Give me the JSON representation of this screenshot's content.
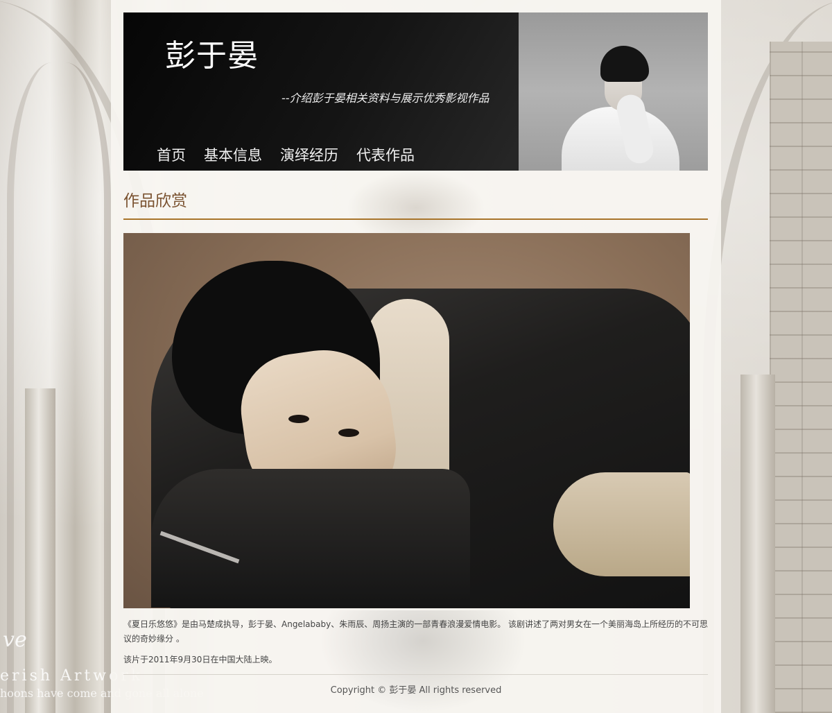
{
  "header": {
    "title": "彭于晏",
    "subtitle": "--介绍彭于晏相关资料与展示优秀影视作品",
    "nav": [
      {
        "label": "首页"
      },
      {
        "label": "基本信息"
      },
      {
        "label": "演绎经历"
      },
      {
        "label": "代表作品"
      }
    ],
    "photo": "portrait-photo"
  },
  "section": {
    "title": "作品欣赏",
    "accent_color": "#a8742a",
    "title_color": "#7a5230"
  },
  "feature": {
    "image": "feature-photo"
  },
  "description": {
    "paragraph_1": "《夏日乐悠悠》是由马楚成执导，彭于晏、Angelababy、朱雨辰、周扬主演的一部青春浪漫爱情电影。 该剧讲述了两对男女在一个美丽海岛上所经历的不可思议的奇妙缘分 。",
    "paragraph_2": "该片于2011年9月30日在中国大陆上映。"
  },
  "background": {
    "line_1": "ve",
    "line_2": "erish Artwork",
    "line_3": "hoons have come and gone all alone"
  },
  "footer": {
    "copyright": "Copyright © 彭于晏 All rights reserved"
  }
}
